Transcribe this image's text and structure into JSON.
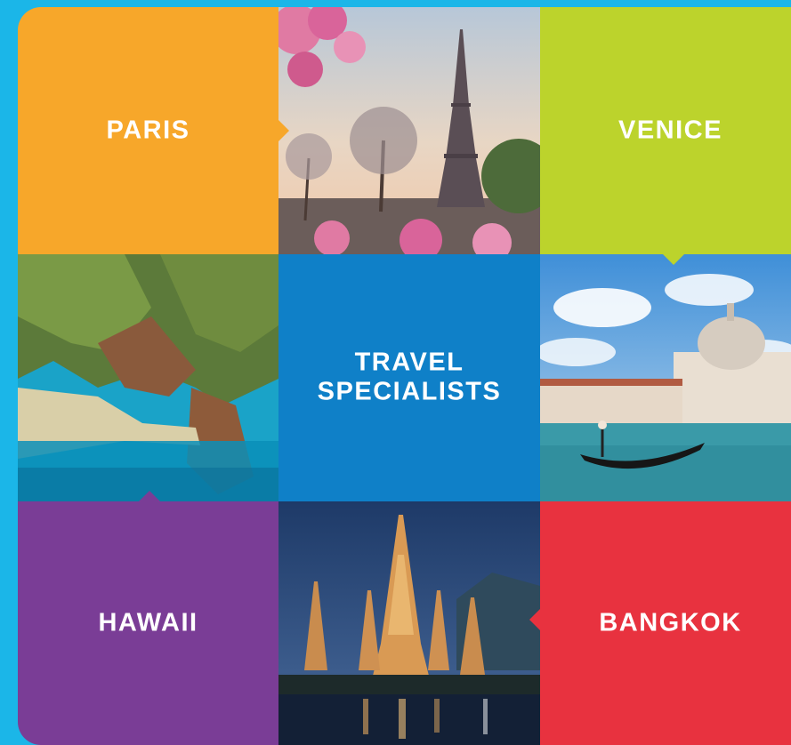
{
  "tiles": {
    "paris": {
      "label": "PARIS",
      "color": "#f7a72a"
    },
    "venice": {
      "label": "VENICE",
      "color": "#bcd32c"
    },
    "center": {
      "line1": "TRAVEL",
      "line2": "SPECIALISTS",
      "color": "#0f80c8"
    },
    "hawaii": {
      "label": "HAWAII",
      "color": "#7a3d96"
    },
    "bangkok": {
      "label": "BANGKOK",
      "color": "#e8323f"
    }
  },
  "photos": {
    "paris": "eiffel-tower-photo",
    "hawaii": "hawaii-coast-photo",
    "venice": "venice-basilica-gondola-photo",
    "bangkok": "bangkok-temple-night-photo"
  },
  "background_color": "#1bb6e8"
}
